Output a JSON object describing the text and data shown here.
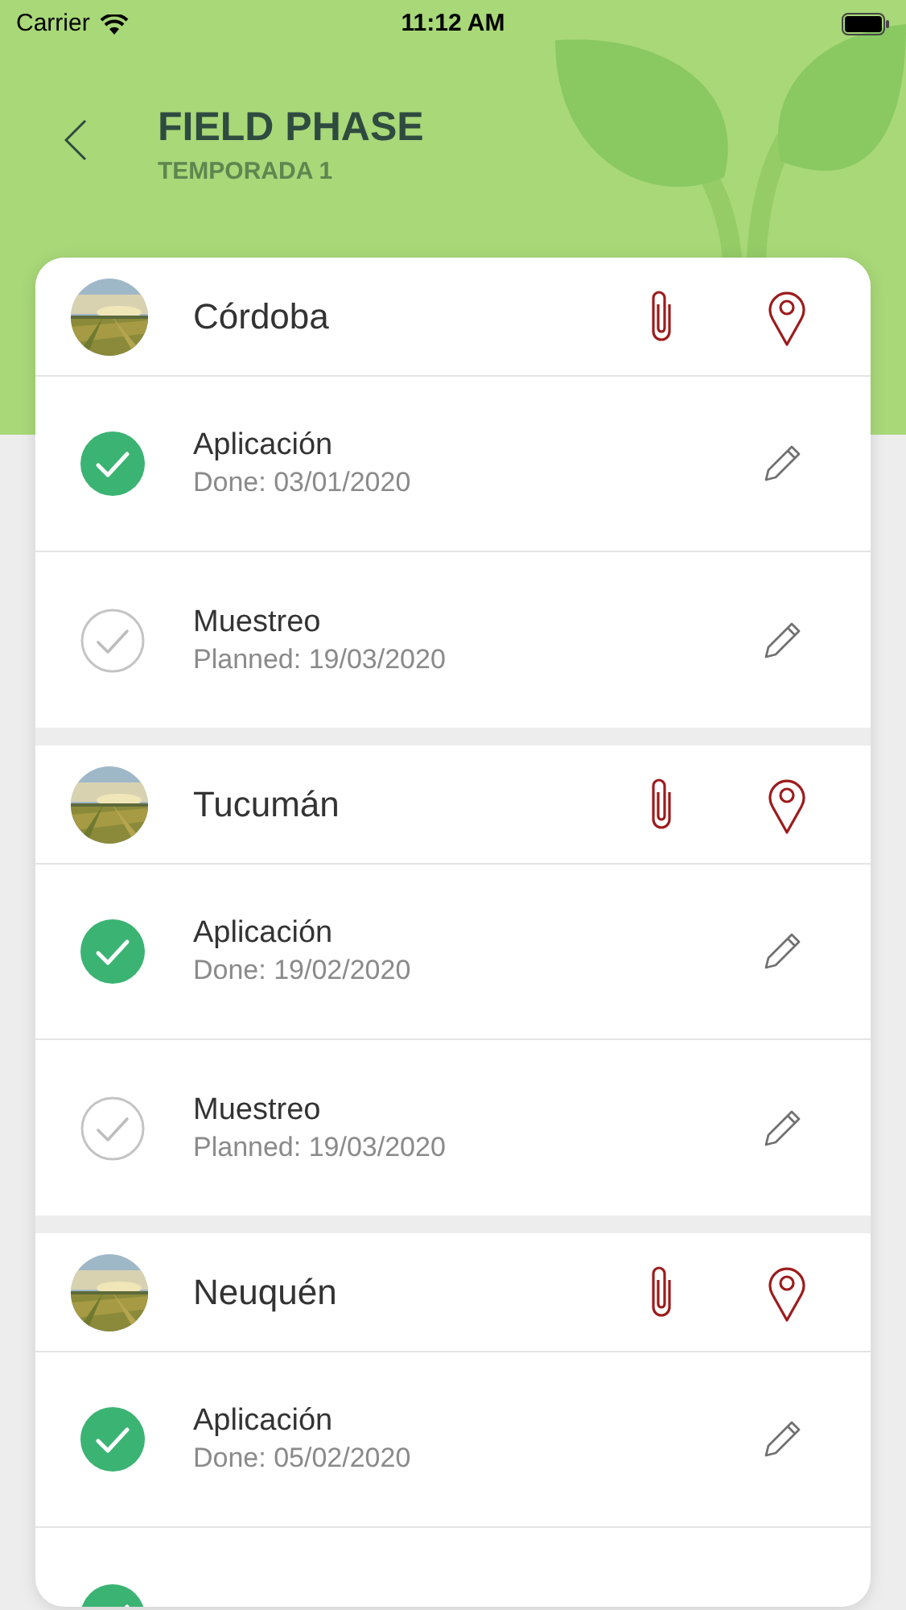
{
  "status_bar": {
    "carrier": "Carrier",
    "time": "11:12 AM"
  },
  "header": {
    "title": "FIELD PHASE",
    "subtitle": "TEMPORADA 1"
  },
  "fields": [
    {
      "name": "Córdoba",
      "tasks": [
        {
          "title": "Aplicación",
          "date": "Done: 03/01/2020",
          "done": true
        },
        {
          "title": "Muestreo",
          "date": "Planned: 19/03/2020",
          "done": false
        }
      ]
    },
    {
      "name": "Tucumán",
      "tasks": [
        {
          "title": "Aplicación",
          "date": "Done: 19/02/2020",
          "done": true
        },
        {
          "title": "Muestreo",
          "date": "Planned: 19/03/2020",
          "done": false
        }
      ]
    },
    {
      "name": "Neuquén",
      "tasks": [
        {
          "title": "Aplicación",
          "date": "Done: 05/02/2020",
          "done": true
        },
        {
          "done": true
        }
      ]
    }
  ]
}
